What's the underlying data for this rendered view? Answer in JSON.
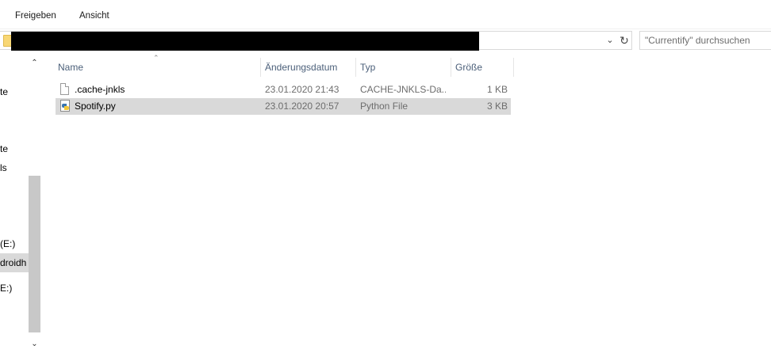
{
  "ribbon": {
    "tabs": [
      "Freigeben",
      "Ansicht"
    ]
  },
  "address": {
    "dropdown_icon": "chevron-down-icon",
    "refresh_icon": "refresh-icon",
    "path_redacted": true
  },
  "search": {
    "placeholder": "\"Currentify\" durchsuchen"
  },
  "nav": {
    "items": [
      {
        "label": "te"
      },
      {
        "label": "te"
      },
      {
        "label": "ls"
      },
      {
        "label": "(E:)"
      },
      {
        "label": "droidh"
      },
      {
        "label": "E:)"
      }
    ],
    "scroll_up_icon": "chevron-up-icon",
    "scroll_down_icon": "chevron-down-icon"
  },
  "columns": {
    "name": "Name",
    "date": "Änderungsdatum",
    "type": "Typ",
    "size": "Größe"
  },
  "files": [
    {
      "name": ".cache-jnkls",
      "date": "23.01.2020 21:43",
      "type": "CACHE-JNKLS-Da...",
      "size": "1 KB",
      "icon": "file-icon"
    },
    {
      "name": "Spotify.py",
      "date": "23.01.2020 20:57",
      "type": "Python File",
      "size": "3 KB",
      "icon": "python-file-icon",
      "selected": true
    }
  ],
  "colors": {
    "selection": "#d9d9d9",
    "header_text": "#4c607a",
    "secondary_text": "#6d6d6d"
  }
}
